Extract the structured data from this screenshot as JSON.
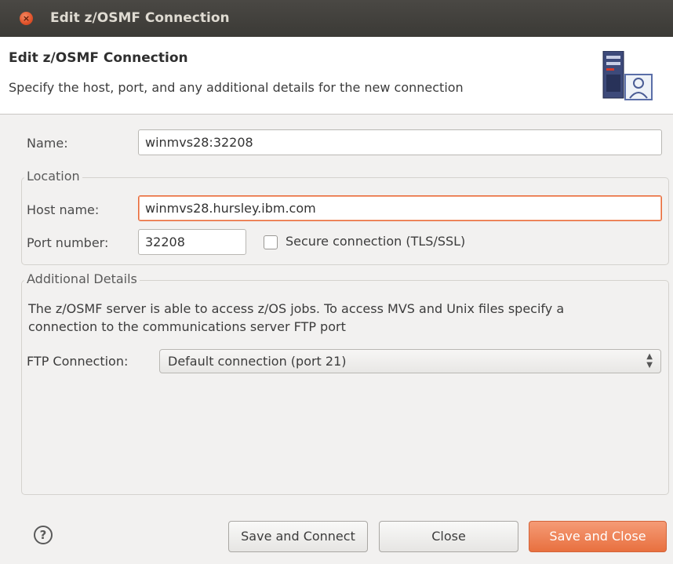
{
  "window": {
    "title": "Edit z/OSMF Connection",
    "close_glyph": "×"
  },
  "header": {
    "title": "Edit z/OSMF Connection",
    "description": "Specify the host, port, and any additional details for the new connection",
    "icon": "server-user-icon"
  },
  "form": {
    "name_label": "Name:",
    "name_value": "winmvs28:32208",
    "location": {
      "group_label": "Location",
      "host_label": "Host name:",
      "host_value": "winmvs28.hursley.ibm.com",
      "port_label": "Port number:",
      "port_value": "32208",
      "secure_label": "Secure connection (TLS/SSL)",
      "secure_checked": false
    },
    "additional": {
      "group_label": "Additional Details",
      "info_line1": "The z/OSMF server is able to access z/OS jobs. To access MVS and Unix files specify a",
      "info_line2": "connection to the communications server FTP port",
      "ftp_label": "FTP Connection:",
      "ftp_selected": "Default connection (port 21)"
    }
  },
  "footer": {
    "help_glyph": "?",
    "save_connect_label": "Save and Connect",
    "close_label": "Close",
    "save_close_label": "Save and Close"
  },
  "colors": {
    "accent": "#e8703f",
    "titlebar": "#3b3a36",
    "background": "#f2f1f0"
  }
}
